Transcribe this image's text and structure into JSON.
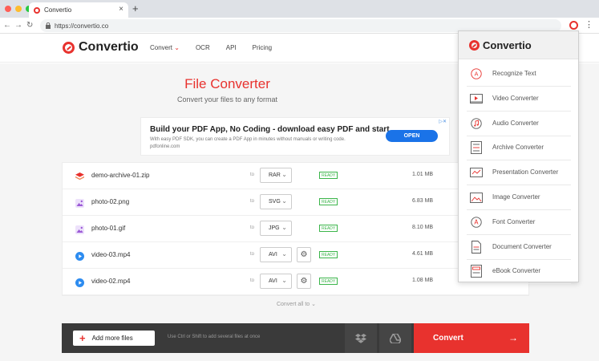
{
  "browser": {
    "tab_title": "Convertio",
    "url": "https://convertio.co",
    "new_tab": "+",
    "close": "×"
  },
  "site": {
    "brand": "Convertio",
    "menu": [
      "Convert",
      "OCR",
      "API",
      "Pricing"
    ],
    "title": "File Converter",
    "subtitle": "Convert your files to any format"
  },
  "ad": {
    "title": "Build your PDF App, No Coding - download easy PDF and start",
    "text": "With easy PDF SDK, you can create a PDF App in minutes without manuals or writing code. pdfonline.com",
    "button": "OPEN"
  },
  "files": [
    {
      "name": "demo-archive-01.zip",
      "to": "to",
      "format": "RAR",
      "status": "READY",
      "size": "1.01 MB",
      "kind": "archive",
      "has_settings": false
    },
    {
      "name": "photo-02.png",
      "to": "to",
      "format": "SVG",
      "status": "READY",
      "size": "6.83 MB",
      "kind": "image",
      "has_settings": false
    },
    {
      "name": "photo-01.gif",
      "to": "to",
      "format": "JPG",
      "status": "READY",
      "size": "8.10 MB",
      "kind": "image",
      "has_settings": false
    },
    {
      "name": "video-03.mp4",
      "to": "to",
      "format": "AVI",
      "status": "READY",
      "size": "4.61 MB",
      "kind": "video",
      "has_settings": true
    },
    {
      "name": "video-02.mp4",
      "to": "to",
      "format": "AVI",
      "status": "READY",
      "size": "1.08 MB",
      "kind": "video",
      "has_settings": true
    }
  ],
  "convert_all": "Convert all to",
  "bottom": {
    "add_files": "Add more files",
    "hint": "Use Ctrl or Shift to add several files at once",
    "convert": "Convert"
  },
  "dropdown": {
    "brand": "Convertio",
    "items": [
      {
        "label": "Recognize Text",
        "icon": "ocr-icon"
      },
      {
        "label": "Video Converter",
        "icon": "video-icon"
      },
      {
        "label": "Audio Converter",
        "icon": "audio-icon"
      },
      {
        "label": "Archive Converter",
        "icon": "archive-icon"
      },
      {
        "label": "Presentation Converter",
        "icon": "presentation-icon"
      },
      {
        "label": "Image Converter",
        "icon": "image-icon"
      },
      {
        "label": "Font Converter",
        "icon": "font-icon"
      },
      {
        "label": "Document Converter",
        "icon": "document-icon"
      },
      {
        "label": "eBook Converter",
        "icon": "ebook-icon"
      }
    ]
  },
  "colors": {
    "accent": "#e8322e",
    "ready": "#3bb54a",
    "ad_button": "#1a73e8",
    "bottom_bar": "#3a3a3a"
  }
}
